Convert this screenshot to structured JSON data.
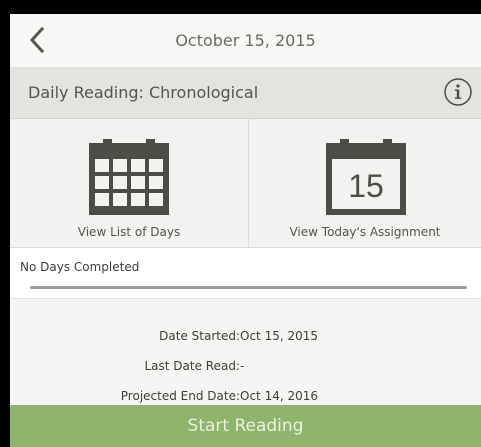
{
  "header": {
    "date_title": "October 15, 2015",
    "back_icon": "chevron-left-icon"
  },
  "plan": {
    "title": "Daily Reading: Chronological",
    "info_icon": "info-icon"
  },
  "tiles": {
    "list_days_label": "View List of Days",
    "list_days_icon": "calendar-grid-icon",
    "today_label": "View Today's Assignment",
    "today_icon": "calendar-day-icon",
    "today_day_number": "15"
  },
  "progress": {
    "label": "No Days Completed",
    "fraction_complete": 0
  },
  "details": {
    "date_started_label": "Date Started:",
    "date_started_value": "Oct 15, 2015",
    "last_date_read_label": "Last Date Read:",
    "last_date_read_value": "-",
    "projected_end_label": "Projected End Date:",
    "projected_end_value": "Oct 14, 2016"
  },
  "actions": {
    "start_label": "Start Reading"
  },
  "colors": {
    "accent_green": "#8fb46c",
    "icon_dark": "#4e4d45",
    "header_bg": "#e3e3e0"
  }
}
